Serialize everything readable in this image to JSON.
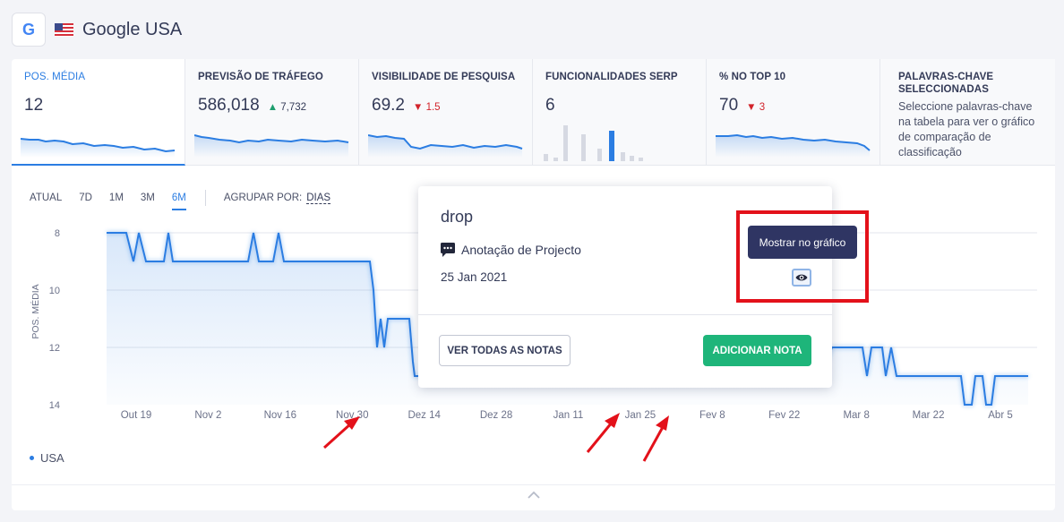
{
  "header": {
    "logo_letter": "G",
    "title": "Google USA"
  },
  "metrics": [
    {
      "label": "POS. MÉDIA",
      "value": "12",
      "delta": "",
      "active": true
    },
    {
      "label": "PREVISÃO DE TRÁFEGO",
      "value": "586,018",
      "delta": "7,732",
      "delta_dir": "up"
    },
    {
      "label": "VISIBILIDADE DE PESQUISA",
      "value": "69.2",
      "delta": "1.5",
      "delta_dir": "down"
    },
    {
      "label": "FUNCIONALIDADES SERP",
      "value": "6",
      "delta": ""
    },
    {
      "label": "% NO TOP 10",
      "value": "70",
      "delta": "3",
      "delta_dir": "down"
    },
    {
      "label": "PALAVRAS-CHAVE SELECCIONADAS",
      "description": "Seleccione palavras-chave na tabela para ver o gráfico de comparação de classificação"
    }
  ],
  "controls": {
    "periods": [
      "ATUAL",
      "7D",
      "1M",
      "3M",
      "6M"
    ],
    "selected_period": "6M",
    "group_by_label": "AGRUPAR POR:",
    "group_by_value": "DIAS"
  },
  "chart_data": {
    "type": "line",
    "ylabel": "POS. MÉDIA",
    "ylim": [
      14,
      8
    ],
    "y_ticks": [
      8,
      10,
      12,
      14
    ],
    "x_ticks": [
      "Out 19",
      "Nov 2",
      "Nov 16",
      "Nov 30",
      "Dez 14",
      "Dez 28",
      "Jan 11",
      "Jan 25",
      "Fev 8",
      "Fev 22",
      "Mar 8",
      "Mar 22",
      "Abr 5"
    ],
    "series": [
      {
        "name": "USA",
        "color": "#2b7de2"
      }
    ],
    "approx_values_by_week": [
      8,
      9,
      9,
      8,
      9,
      9,
      9,
      11,
      10,
      12,
      12,
      12,
      11,
      11,
      12,
      11,
      12,
      12,
      13,
      12
    ],
    "grid": true,
    "legend": "bottom-left",
    "annotation_icons": [
      "google-icon",
      "note-icon",
      "note-icon"
    ]
  },
  "legend": {
    "label": "USA"
  },
  "popup": {
    "title": "drop",
    "type_label": "Anotação de Projecto",
    "date": "25 Jan 2021",
    "tooltip": "Mostrar no gráfico",
    "btn_all_notes": "VER TODAS AS NOTAS",
    "btn_add_note": "ADICIONAR NOTA"
  },
  "colors": {
    "accent": "#2b7de2",
    "green": "#1eb57a",
    "red_annotation": "#e3111a",
    "tooltip_bg": "#2f3563"
  }
}
